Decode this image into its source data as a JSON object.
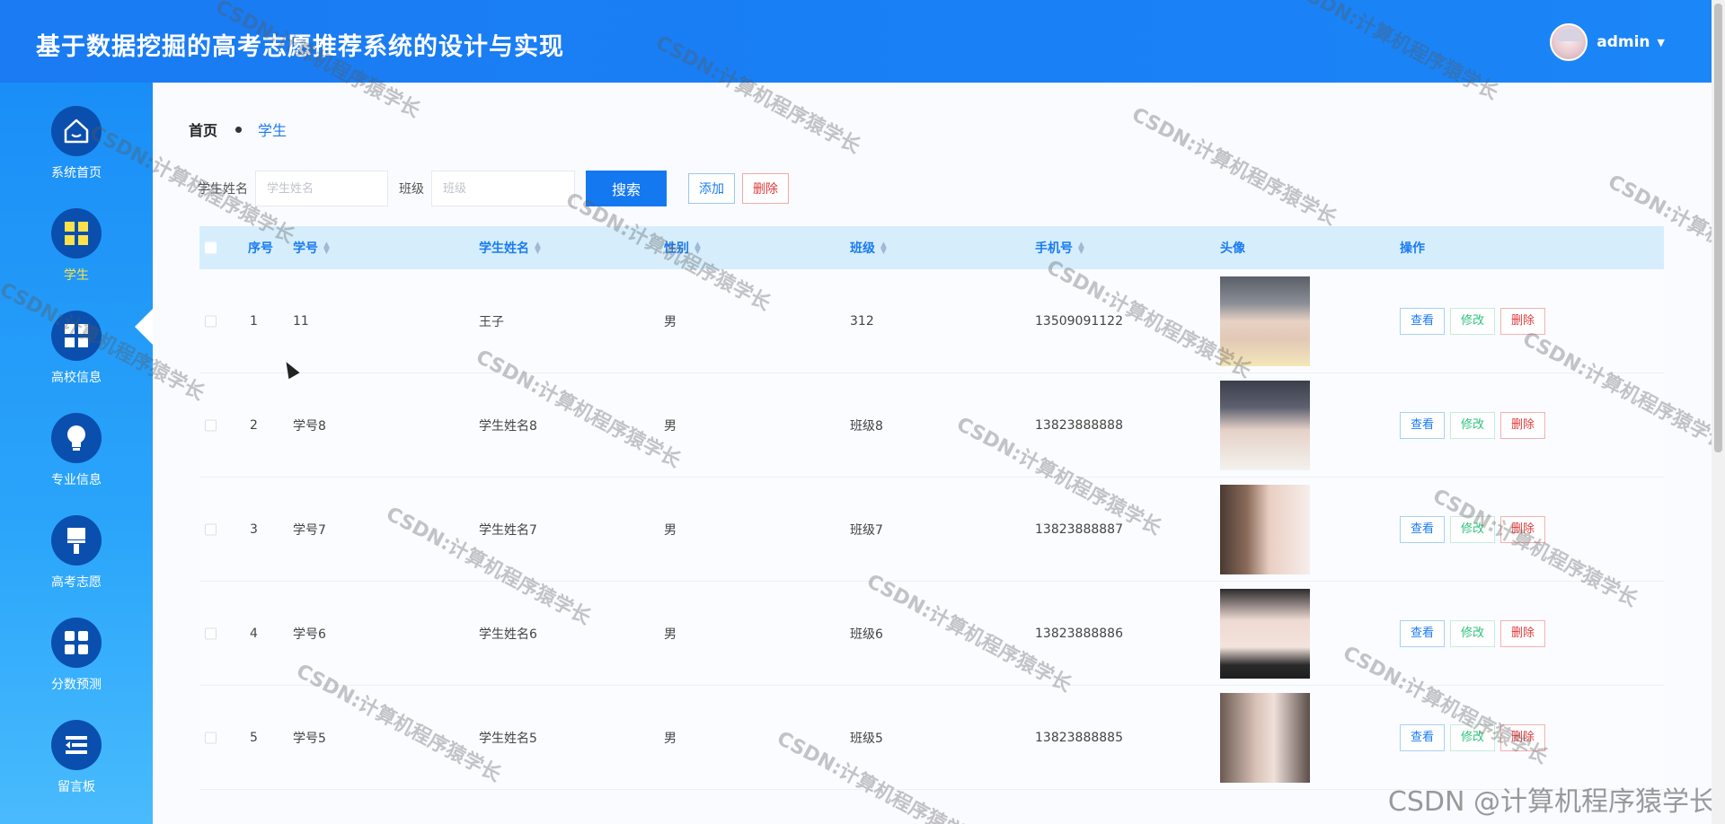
{
  "header": {
    "title": "基于数据挖掘的高考志愿推荐系统的设计与实现",
    "username": "admin"
  },
  "sidebar": {
    "items": [
      {
        "label": "系统首页",
        "icon": "home-icon"
      },
      {
        "label": "学生",
        "icon": "grid-icon",
        "active": true
      },
      {
        "label": "高校信息",
        "icon": "grid-icon"
      },
      {
        "label": "专业信息",
        "icon": "bulb-icon"
      },
      {
        "label": "高考志愿",
        "icon": "brush-icon"
      },
      {
        "label": "分数预测",
        "icon": "grid-icon"
      },
      {
        "label": "留言板",
        "icon": "list-icon"
      }
    ]
  },
  "breadcrumb": {
    "home": "首页",
    "current": "学生"
  },
  "search": {
    "name_label": "学生姓名",
    "name_placeholder": "学生姓名",
    "class_label": "班级",
    "class_placeholder": "班级",
    "search_button": "搜索",
    "add_button": "添加",
    "delete_button": "删除"
  },
  "table": {
    "headers": {
      "index": "序号",
      "student_no": "学号",
      "name": "学生姓名",
      "gender": "性别",
      "class": "班级",
      "phone": "手机号",
      "avatar": "头像",
      "actions": "操作"
    },
    "actions": {
      "view": "查看",
      "edit": "修改",
      "delete": "删除"
    },
    "rows": [
      {
        "index": "1",
        "student_no": "11",
        "name": "王子",
        "gender": "男",
        "class": "312",
        "phone": "13509091122"
      },
      {
        "index": "2",
        "student_no": "学号8",
        "name": "学生姓名8",
        "gender": "男",
        "class": "班级8",
        "phone": "13823888888"
      },
      {
        "index": "3",
        "student_no": "学号7",
        "name": "学生姓名7",
        "gender": "男",
        "class": "班级7",
        "phone": "13823888887"
      },
      {
        "index": "4",
        "student_no": "学号6",
        "name": "学生姓名6",
        "gender": "男",
        "class": "班级6",
        "phone": "13823888886"
      },
      {
        "index": "5",
        "student_no": "学号5",
        "name": "学生姓名5",
        "gender": "男",
        "class": "班级5",
        "phone": "13823888885"
      }
    ]
  },
  "watermark": {
    "text": "CSDN:计算机程序猿学长",
    "corner": "CSDN @计算机程序猿学长"
  },
  "colors": {
    "primary": "#1478f0",
    "sidebar_icon_bg": "#0a4fae",
    "active_label": "#ffe24a",
    "table_header_bg": "#d6eefc",
    "danger": "#e03a3a",
    "success": "#2ec27e"
  }
}
